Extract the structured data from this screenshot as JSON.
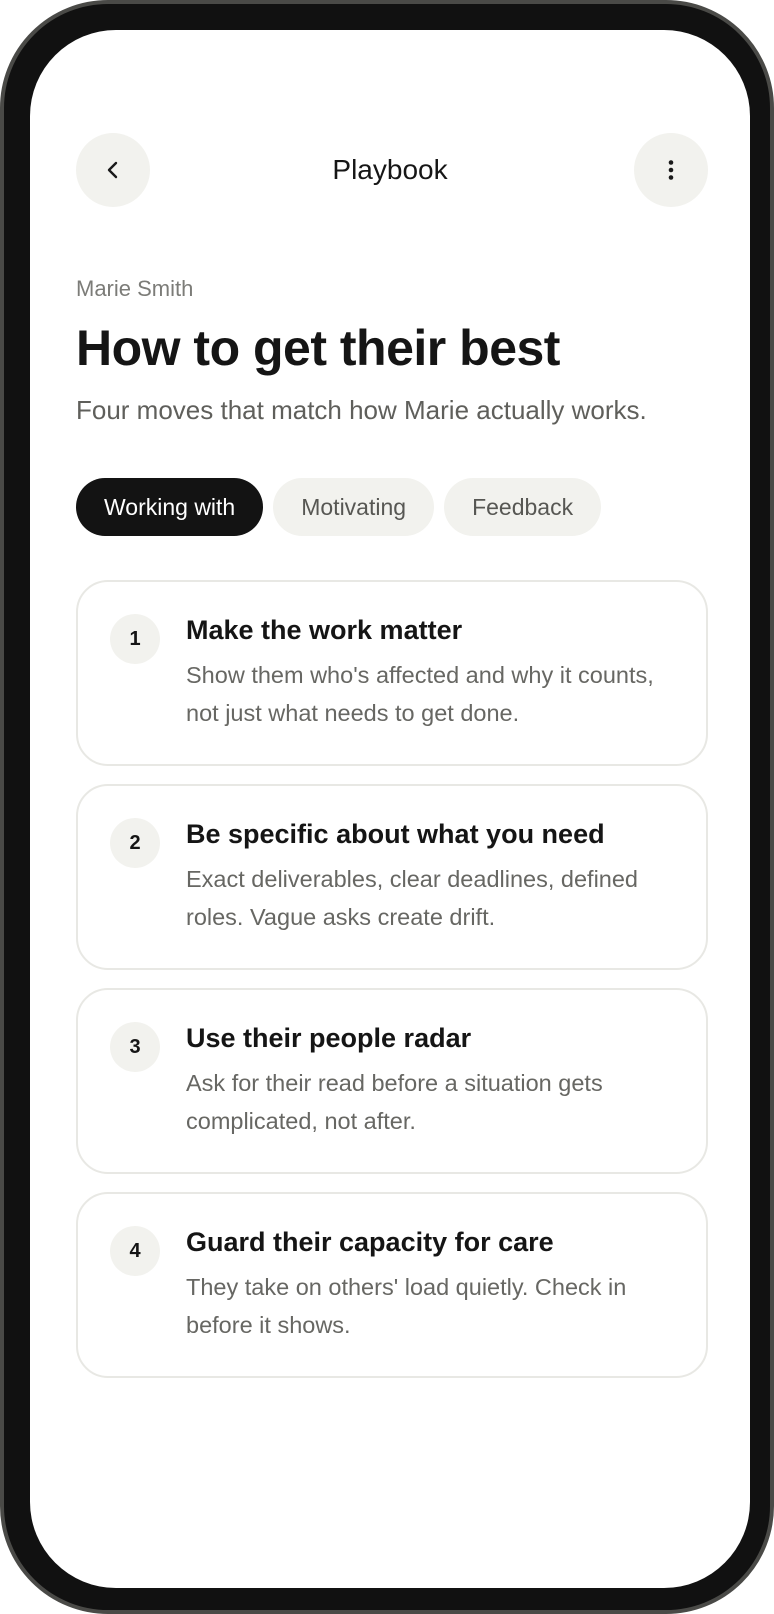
{
  "header": {
    "title": "Playbook",
    "back_icon": "chevron-left-icon",
    "more_icon": "more-vertical-icon"
  },
  "profile": {
    "name": "Marie Smith"
  },
  "page": {
    "title": "How to get their best",
    "subtitle": "Four moves that match how Marie actually works."
  },
  "tabs": [
    {
      "label": "Working with",
      "active": true
    },
    {
      "label": "Motivating",
      "active": false
    },
    {
      "label": "Feedback",
      "active": false
    }
  ],
  "moves": [
    {
      "number": "1",
      "title": "Make the work matter",
      "description": "Show them who's affected and why it counts, not just what needs to get done."
    },
    {
      "number": "2",
      "title": "Be specific about what you need",
      "description": "Exact deliverables, clear deadlines, defined roles. Vague asks create drift."
    },
    {
      "number": "3",
      "title": "Use their people radar",
      "description": "Ask for their read before a situation gets complicated, not after."
    },
    {
      "number": "4",
      "title": "Guard their capacity for care",
      "description": "They take on others' load quietly. Check in before it shows."
    }
  ],
  "colors": {
    "accent": "#131313",
    "chip_background": "#f2f2ee",
    "card_border": "#e8e8e4",
    "device_frame": "#111111"
  }
}
